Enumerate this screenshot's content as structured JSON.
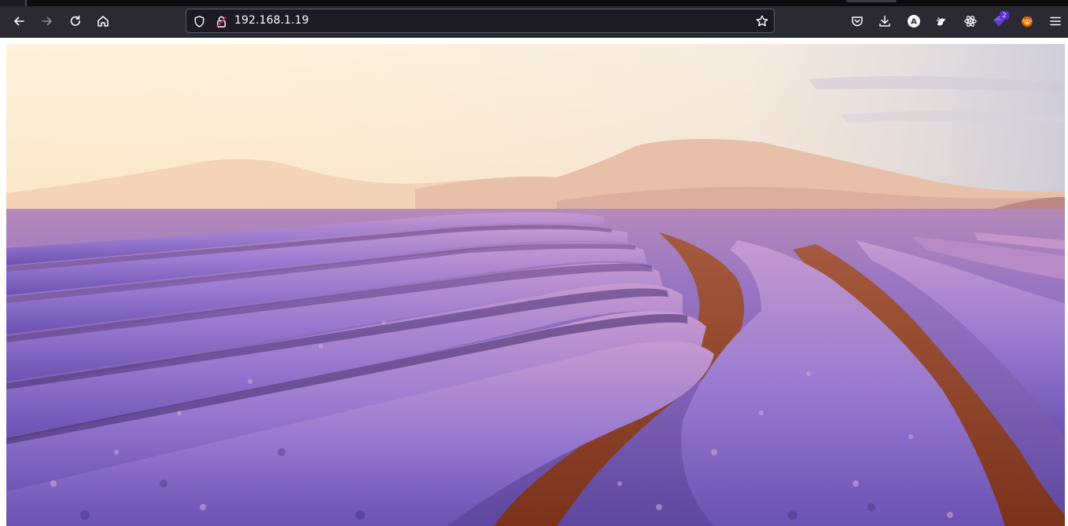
{
  "browser": {
    "url": "192.168.1.19",
    "extensions": {
      "badge_count": "2"
    },
    "avatar_letter": "A"
  },
  "colors": {
    "toolbar_bg": "#2b2a33",
    "urlbar_bg": "#1c1b22",
    "sky_top": "#fdf1d8",
    "lavender": "#7d5fb8",
    "soil": "#8a3e22"
  },
  "icons": {
    "nav": [
      "back-arrow-icon",
      "forward-arrow-icon",
      "reload-icon",
      "home-icon"
    ],
    "urlbar": [
      "tracking-shield-icon",
      "insecure-lock-icon",
      "bookmark-star-icon"
    ],
    "right": [
      "pocket-icon",
      "downloads-icon",
      "account-avatar-icon",
      "ublock-style-extension-icon",
      "react-devtools-icon",
      "extension-gem-icon",
      "firefox-fox-extension-icon",
      "hamburger-menu-icon"
    ]
  }
}
